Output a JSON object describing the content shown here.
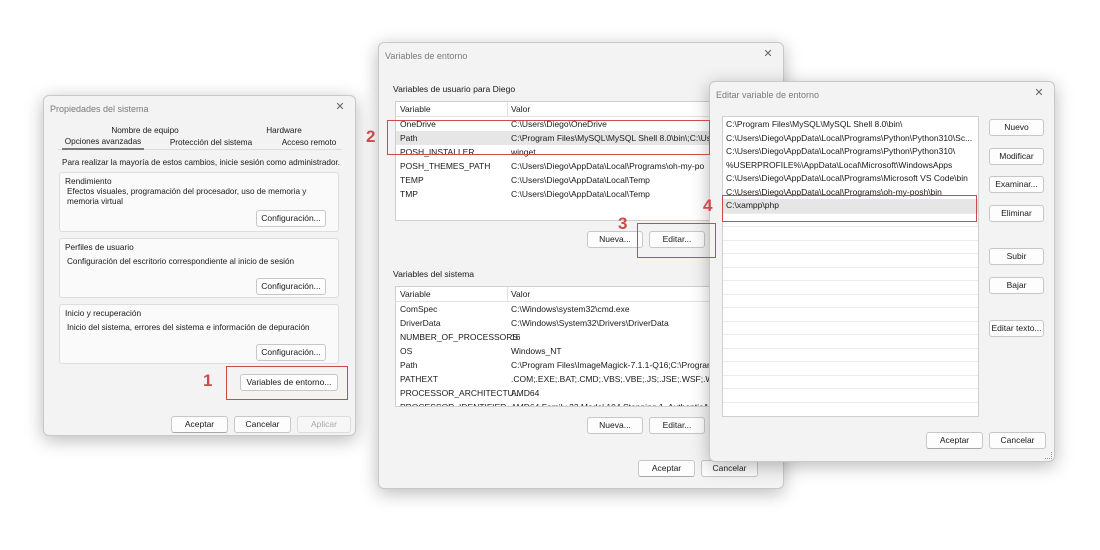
{
  "system_props": {
    "title": "Propiedades del sistema",
    "tabs": [
      "Nombre de equipo",
      "Hardware",
      "Opciones avanzadas",
      "Protección del sistema",
      "Acceso remoto"
    ],
    "admin_note": "Para realizar la mayoría de estos cambios, inicie sesión como administrador.",
    "performance": {
      "title": "Rendimiento",
      "text": "Efectos visuales, programación del procesador, uso de memoria y memoria virtual",
      "button": "Configuración..."
    },
    "profiles": {
      "title": "Perfiles de usuario",
      "text": "Configuración del escritorio correspondiente al inicio de sesión",
      "button": "Configuración..."
    },
    "startup": {
      "title": "Inicio y recuperación",
      "text": "Inicio del sistema, errores del sistema e información de depuración",
      "button": "Configuración..."
    },
    "env_button": "Variables de entorno...",
    "ok": "Aceptar",
    "cancel": "Cancelar",
    "apply": "Aplicar"
  },
  "env_vars": {
    "title": "Variables de entorno",
    "user_section": "Variables de usuario para Diego",
    "col_variable": "Variable",
    "col_value": "Valor",
    "user_rows": [
      {
        "name": "OneDrive",
        "value": "C:\\Users\\Diego\\OneDrive"
      },
      {
        "name": "Path",
        "value": "C:\\Program Files\\MySQL\\MySQL Shell 8.0\\bin\\;C:\\Use"
      },
      {
        "name": "POSH_INSTALLER",
        "value": "winget"
      },
      {
        "name": "POSH_THEMES_PATH",
        "value": "C:\\Users\\Diego\\AppData\\Local\\Programs\\oh-my-po"
      },
      {
        "name": "TEMP",
        "value": "C:\\Users\\Diego\\AppData\\Local\\Temp"
      },
      {
        "name": "TMP",
        "value": "C:\\Users\\Diego\\AppData\\Local\\Temp"
      }
    ],
    "user_new": "Nueva...",
    "user_edit": "Editar...",
    "system_section": "Variables del sistema",
    "system_rows": [
      {
        "name": "ComSpec",
        "value": "C:\\Windows\\system32\\cmd.exe"
      },
      {
        "name": "DriverData",
        "value": "C:\\Windows\\System32\\Drivers\\DriverData"
      },
      {
        "name": "NUMBER_OF_PROCESSORS",
        "value": "16"
      },
      {
        "name": "OS",
        "value": "Windows_NT"
      },
      {
        "name": "Path",
        "value": "C:\\Program Files\\ImageMagick-7.1.1-Q16;C:\\Program"
      },
      {
        "name": "PATHEXT",
        "value": ".COM;.EXE;.BAT;.CMD;.VBS;.VBE;.JS;.JSE;.WSF;.WSH;.MS"
      },
      {
        "name": "PROCESSOR_ARCHITECTU...",
        "value": "AMD64"
      },
      {
        "name": "PROCESSOR_IDENTIFIER",
        "value": "AMD64 Family 23 Model 104 Stepping 1, AuthenticA"
      }
    ],
    "system_new": "Nueva...",
    "system_edit": "Editar...",
    "ok": "Aceptar",
    "cancel": "Cancelar"
  },
  "edit_var": {
    "title": "Editar variable de entorno",
    "entries": [
      "C:\\Program Files\\MySQL\\MySQL Shell 8.0\\bin\\",
      "C:\\Users\\Diego\\AppData\\Local\\Programs\\Python\\Python310\\Sc...",
      "C:\\Users\\Diego\\AppData\\Local\\Programs\\Python\\Python310\\",
      "%USERPROFILE%\\AppData\\Local\\Microsoft\\WindowsApps",
      "C:\\Users\\Diego\\AppData\\Local\\Programs\\Microsoft VS Code\\bin",
      "C:\\Users\\Diego\\AppData\\Local\\Programs\\oh-my-posh\\bin",
      "C:\\xampp\\php"
    ],
    "buttons": {
      "new": "Nuevo",
      "modify": "Modificar",
      "browse": "Examinar...",
      "delete": "Eliminar",
      "up": "Subir",
      "down": "Bajar",
      "edit_text": "Editar texto..."
    },
    "ok": "Aceptar",
    "cancel": "Cancelar"
  },
  "steps": [
    "1",
    "2",
    "3",
    "4"
  ],
  "colors": {
    "highlight": "#cc4a4a",
    "selected_row": "#e6e6e6",
    "window_bg": "#f3f3f3"
  }
}
